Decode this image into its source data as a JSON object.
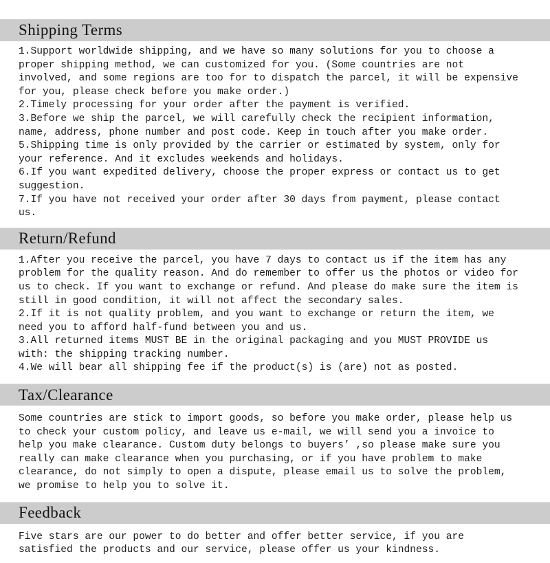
{
  "document": {
    "title": "Shipping Terms / Return-Refund / Tax-Clearance / Feedback policy panel",
    "header_background": "#cccccc",
    "page_background": "#ffffff",
    "text_color": "#1b1b1b"
  },
  "sections": [
    {
      "id": "shipping-terms",
      "heading": "Shipping Terms",
      "lines": [
        "1.Support worldwide shipping, and we have so many solutions for you to choose a",
        "proper shipping method, we can customized for you. (Some countries are not",
        "involved, and some regions are too for to dispatch the parcel, it will be expensive",
        "for you, please check before you make order.)",
        "2.Timely processing for your order after the payment is verified.",
        "3.Before we ship the parcel, we will carefully check the recipient information,",
        "name, address, phone number and post code. Keep in touch after you make order.",
        "5.Shipping time is only provided by the carrier or estimated by system, only for",
        "your reference. And it excludes weekends and holidays.",
        "6.If you want expedited delivery, choose the proper express or contact us to get",
        "suggestion.",
        "7.If you have not received your order after 30 days from payment, please contact",
        "us."
      ]
    },
    {
      "id": "return-refund",
      "heading": "Return/Refund",
      "lines": [
        "1.After you receive the parcel, you have 7 days to contact us if the item has any",
        "problem for the quality reason. And do remember to offer us the photos or video for",
        "us to check. If you want to exchange or refund. And please do make sure the item is",
        "still in good condition, it will not affect the secondary sales.",
        "2.If it is not quality problem, and you want to exchange or return the item, we",
        "need you to afford half-fund between you and us.",
        "3.All returned items MUST BE in the original packaging and you MUST PROVIDE us",
        "with: the shipping tracking number.",
        "4.We will bear all shipping fee if the product(s) is (are) not as posted."
      ]
    },
    {
      "id": "tax-clearance",
      "heading": "Tax/Clearance",
      "lines": [
        "Some countries are stick to import goods, so before you make order, please help us",
        "to check your custom policy, and leave us e-mail, we will send you a invoice to",
        "help you make clearance. Custom duty belongs to buyers’ ,so please make sure you",
        "really can make clearance when you purchasing, or if you have problem to make",
        "clearance, do not simply to open a dispute, please email us to solve the problem,",
        "we promise to help you to solve it."
      ]
    },
    {
      "id": "feedback",
      "heading": "Feedback",
      "lines": [
        "Five stars are our power to do better and offer better service, if you are",
        "satisfied the products and our service, please offer us your kindness."
      ]
    }
  ]
}
